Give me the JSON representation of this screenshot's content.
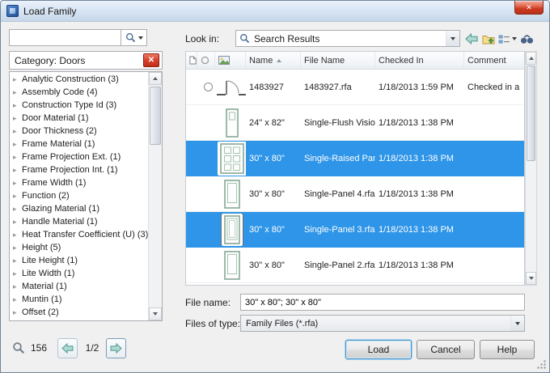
{
  "window": {
    "title": "Load Family"
  },
  "icons": {
    "close": "✕",
    "clear": "✕"
  },
  "left": {
    "search_value": "",
    "category_header": "Category: Doors",
    "tree_items": [
      {
        "label": "Analytic Construction (3)"
      },
      {
        "label": "Assembly Code (4)"
      },
      {
        "label": "Construction Type Id (3)"
      },
      {
        "label": "Door Material (1)"
      },
      {
        "label": "Door Thickness (2)"
      },
      {
        "label": "Frame Material (1)"
      },
      {
        "label": "Frame Projection Ext. (1)"
      },
      {
        "label": "Frame Projection Int. (1)"
      },
      {
        "label": "Frame Width (1)"
      },
      {
        "label": "Function (2)"
      },
      {
        "label": "Glazing Material (1)"
      },
      {
        "label": "Handle Material (1)"
      },
      {
        "label": "Heat Transfer Coefficient (U) (3)"
      },
      {
        "label": "Height (5)"
      },
      {
        "label": "Lite Height (1)"
      },
      {
        "label": "Lite Width (1)"
      },
      {
        "label": "Material (1)"
      },
      {
        "label": "Muntin (1)"
      },
      {
        "label": "Offset (2)"
      }
    ],
    "results_count": "156",
    "page": "1/2"
  },
  "right": {
    "look_in": {
      "label": "Look in:",
      "value": "Search Results"
    },
    "table": {
      "headers": {
        "name": "Name",
        "file": "File Name",
        "checked": "Checked In",
        "comment": "Comment"
      },
      "rows": [
        {
          "thumb": "plan",
          "radio": true,
          "name": "1483927",
          "file": "1483927.rfa",
          "checked": "1/18/2013 1:59 PM",
          "comment": "Checked in a",
          "selected": false,
          "focused": false
        },
        {
          "thumb": "vision",
          "radio": false,
          "name": "24\" x 82\"",
          "file": "Single-Flush Vision.rfa",
          "checked": "1/18/2013 1:38 PM",
          "comment": "",
          "selected": false,
          "focused": false
        },
        {
          "thumb": "raised",
          "radio": false,
          "name": "30\" x 80\"",
          "file": "Single-Raised Panel w...",
          "checked": "1/18/2013 1:38 PM",
          "comment": "",
          "selected": true,
          "focused": false
        },
        {
          "thumb": "panel",
          "radio": false,
          "name": "30\" x 80\"",
          "file": "Single-Panel 4.rfa",
          "checked": "1/18/2013 1:38 PM",
          "comment": "",
          "selected": false,
          "focused": false
        },
        {
          "thumb": "panel2",
          "radio": false,
          "name": "30\" x 80\"",
          "file": "Single-Panel 3.rfa",
          "checked": "1/18/2013 1:38 PM",
          "comment": "",
          "selected": true,
          "focused": true
        },
        {
          "thumb": "panel",
          "radio": false,
          "name": "30\" x 80\"",
          "file": "Single-Panel 2.rfa",
          "checked": "1/18/2013 1:38 PM",
          "comment": "",
          "selected": false,
          "focused": false
        }
      ]
    },
    "file_name": {
      "label": "File name:",
      "value": "30\" x 80\"; 30\" x 80\""
    },
    "files_of_type": {
      "label": "Files of type:",
      "value": "Family Files (*.rfa)"
    }
  },
  "buttons": {
    "load": "Load",
    "cancel": "Cancel",
    "help": "Help"
  }
}
